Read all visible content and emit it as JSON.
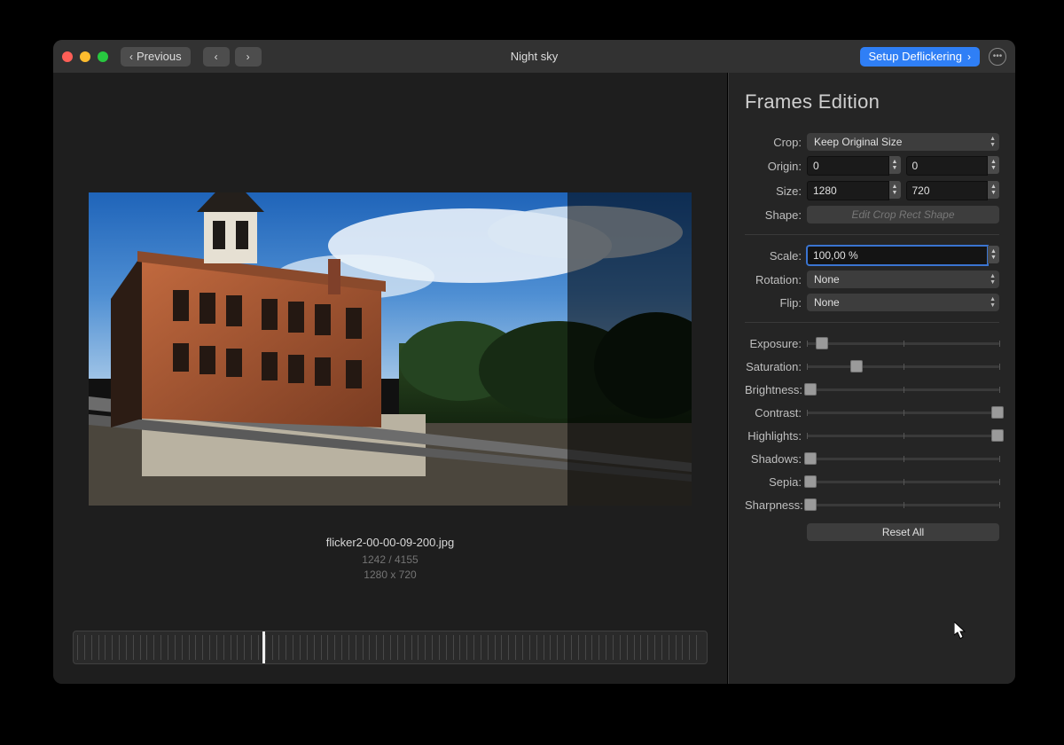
{
  "window": {
    "title": "Night sky"
  },
  "toolbar": {
    "previous_label": "Previous",
    "setup_label": "Setup Deflickering"
  },
  "panel": {
    "title": "Frames Edition",
    "crop_label": "Crop:",
    "crop_value": "Keep Original Size",
    "origin_label": "Origin:",
    "origin_x": "0",
    "origin_y": "0",
    "size_label": "Size:",
    "size_w": "1280",
    "size_h": "720",
    "shape_label": "Shape:",
    "shape_button": "Edit Crop Rect Shape",
    "scale_label": "Scale:",
    "scale_value": "100,00 %",
    "rotation_label": "Rotation:",
    "rotation_value": "None",
    "flip_label": "Flip:",
    "flip_value": "None",
    "sliders": {
      "exposure": {
        "label": "Exposure:",
        "pos": 8
      },
      "saturation": {
        "label": "Saturation:",
        "pos": 26
      },
      "brightness": {
        "label": "Brightness:",
        "pos": 2
      },
      "contrast": {
        "label": "Contrast:",
        "pos": 99
      },
      "highlights": {
        "label": "Highlights:",
        "pos": 99
      },
      "shadows": {
        "label": "Shadows:",
        "pos": 2
      },
      "sepia": {
        "label": "Sepia:",
        "pos": 2
      },
      "sharpness": {
        "label": "Sharpness:",
        "pos": 2
      }
    },
    "reset_label": "Reset All"
  },
  "preview": {
    "filename": "flicker2-00-00-09-200.jpg",
    "counter": "1242 / 4155",
    "dimensions": "1280 x 720",
    "scrubber_percent": 29.9
  }
}
